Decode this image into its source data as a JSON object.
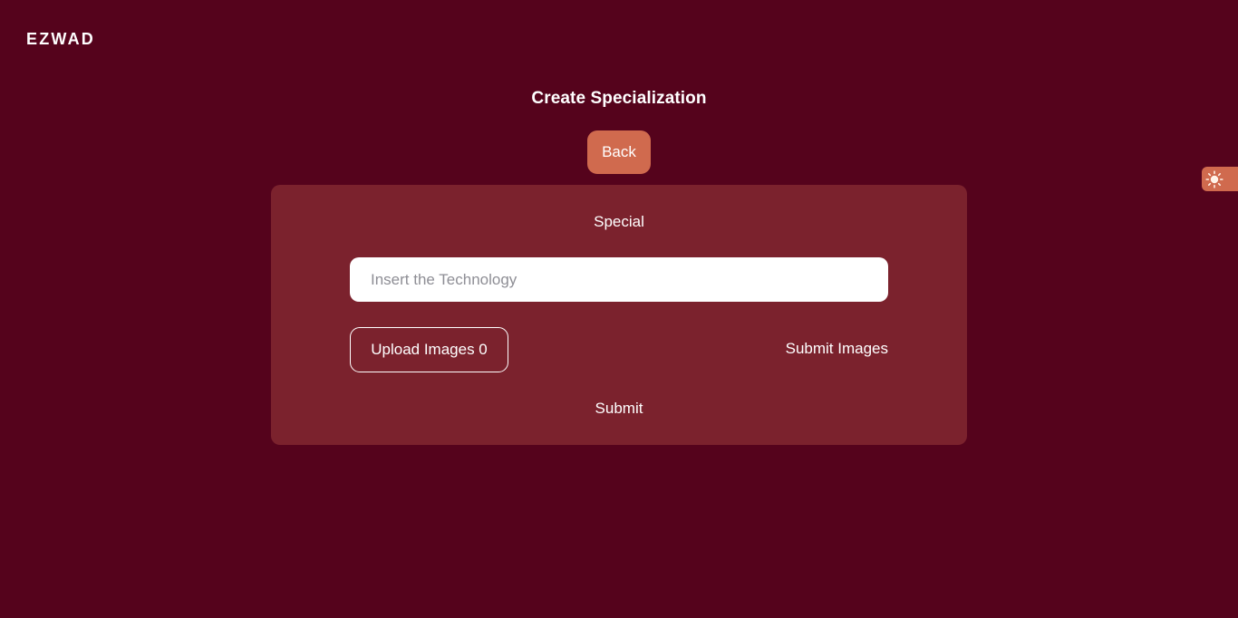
{
  "header": {
    "logo_text": "EZWAD"
  },
  "page": {
    "title": "Create Specialization",
    "back_label": "Back"
  },
  "theme_toggle": {
    "icon": "sun-icon"
  },
  "form": {
    "section_label": "Special",
    "technology_input": {
      "value": "",
      "placeholder": "Insert the Technology"
    },
    "upload_images_label": "Upload Images 0",
    "submit_images_label": "Submit Images",
    "submit_label": "Submit"
  },
  "colors": {
    "background": "#55031c",
    "card": "#7b222d",
    "accent": "#d06a4e",
    "text": "#ffffff"
  }
}
